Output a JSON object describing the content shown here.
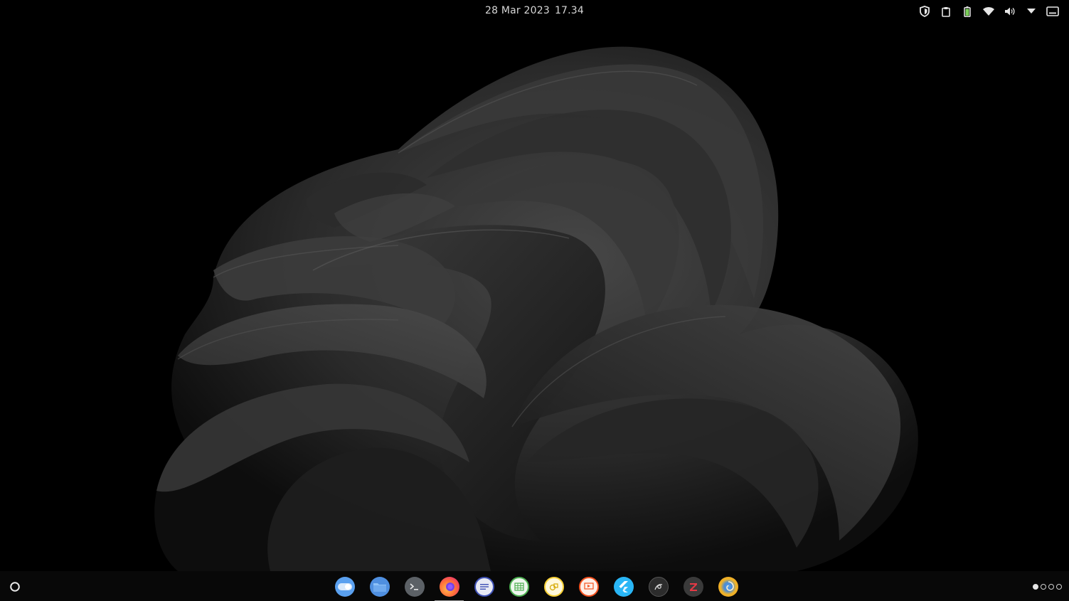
{
  "topbar": {
    "date": "28 Mar 2023",
    "time": "17.34",
    "tray": [
      {
        "name": "shield-icon"
      },
      {
        "name": "clipboard-icon"
      },
      {
        "name": "battery-icon"
      },
      {
        "name": "wifi-icon"
      },
      {
        "name": "volume-icon"
      },
      {
        "name": "chevron-down-icon"
      },
      {
        "name": "keyboard-icon"
      }
    ]
  },
  "dock": {
    "launcher_icon": "circle-launcher-icon",
    "apps": [
      {
        "name": "toggle-settings-icon",
        "color": "#5aa0ef"
      },
      {
        "name": "files-icon",
        "color": "#4f8fe0"
      },
      {
        "name": "terminal-icon",
        "color": "#5c6166"
      },
      {
        "name": "firefox-icon",
        "color": "#ff7139",
        "active": true
      },
      {
        "name": "text-editor-icon",
        "color": "#e8eaf4"
      },
      {
        "name": "spreadsheet-icon",
        "color": "#4caf50"
      },
      {
        "name": "drawing-icon",
        "color": "#f7d035"
      },
      {
        "name": "presentation-icon",
        "color": "#f4511e"
      },
      {
        "name": "flutter-icon",
        "color": "#29b6f6"
      },
      {
        "name": "blender-icon",
        "color": "#2c2c2c"
      },
      {
        "name": "zotero-icon",
        "color": "#cc2936"
      },
      {
        "name": "photos-icon",
        "color": "#f0b429"
      }
    ],
    "workspaces": 4,
    "active_workspace": 1
  },
  "colors": {
    "background": "#000000",
    "dock_background": "#080808",
    "text": "#d7d7d7"
  }
}
